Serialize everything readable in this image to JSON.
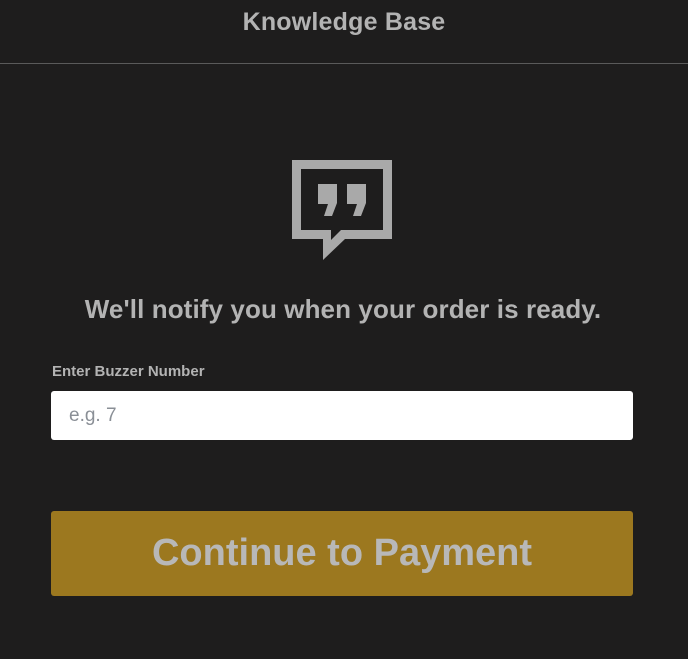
{
  "header": {
    "title": "Knowledge Base"
  },
  "main": {
    "icon": "quote-speech-bubble-icon",
    "message": "We'll notify you when your order is ready.",
    "buzzer": {
      "label": "Enter Buzzer Number",
      "placeholder": "e.g. 7",
      "value": ""
    },
    "continue_label": "Continue to Payment"
  },
  "colors": {
    "background": "#1e1d1d",
    "text": "#b3b3b3",
    "button": "#9c781f",
    "icon": "#a9a9a9"
  }
}
